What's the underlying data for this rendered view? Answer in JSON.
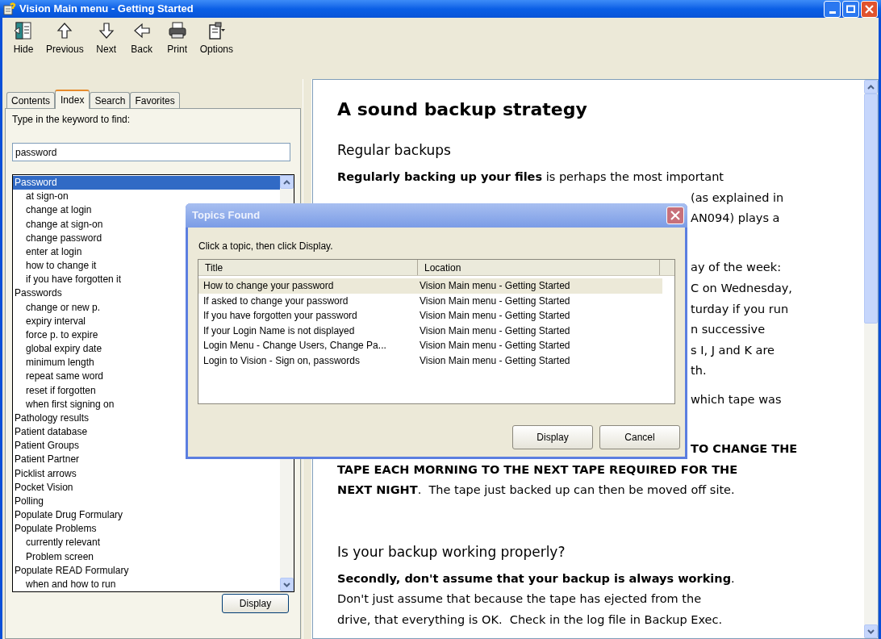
{
  "window": {
    "title": "Vision Main menu - Getting Started"
  },
  "toolbar": [
    {
      "kind": "hide",
      "label": "Hide"
    },
    {
      "kind": "up",
      "label": "Previous"
    },
    {
      "kind": "down",
      "label": "Next"
    },
    {
      "kind": "left",
      "label": "Back"
    },
    {
      "kind": "print",
      "label": "Print"
    },
    {
      "kind": "options",
      "label": "Options"
    }
  ],
  "navigation": {
    "tabs": [
      {
        "label": "Contents",
        "selected": false
      },
      {
        "label": "Index",
        "selected": true
      },
      {
        "label": "Search",
        "selected": false
      },
      {
        "label": "Favorites",
        "selected": false
      }
    ],
    "keyword_label": "Type in the keyword to find:",
    "keyword": "password",
    "index_items": [
      {
        "label": "Password",
        "selected": true,
        "children": [
          {
            "label": "at sign-on",
            "selected": false
          },
          {
            "label": "change at login",
            "selected": false
          },
          {
            "label": "change at sign-on",
            "selected": false
          },
          {
            "label": "change password",
            "selected": false
          },
          {
            "label": "enter at login",
            "selected": false
          },
          {
            "label": "how to change it",
            "selected": false
          },
          {
            "label": "if you have forgotten it",
            "selected": false
          }
        ]
      },
      {
        "label": "Passwords",
        "selected": false,
        "children": [
          {
            "label": "change or new p.",
            "selected": false
          },
          {
            "label": "expiry interval",
            "selected": false
          },
          {
            "label": "force p. to expire",
            "selected": false
          },
          {
            "label": "global expiry date",
            "selected": false
          },
          {
            "label": "minimum length",
            "selected": false
          },
          {
            "label": "repeat same word",
            "selected": false
          },
          {
            "label": "reset if forgotten",
            "selected": false
          },
          {
            "label": "when first signing on",
            "selected": false
          }
        ]
      },
      {
        "label": "Pathology results",
        "selected": false
      },
      {
        "label": "Patient database",
        "selected": false
      },
      {
        "label": "Patient Groups",
        "selected": false
      },
      {
        "label": "Patient Partner",
        "selected": false
      },
      {
        "label": "Picklist arrows",
        "selected": false
      },
      {
        "label": "Pocket Vision",
        "selected": false
      },
      {
        "label": "Polling",
        "selected": false
      },
      {
        "label": "Populate Drug Formulary",
        "selected": false
      },
      {
        "label": "Populate Problems",
        "selected": false,
        "children": [
          {
            "label": "currently relevant",
            "selected": false
          },
          {
            "label": "Problem screen",
            "selected": false
          }
        ]
      },
      {
        "label": "Populate READ Formulary",
        "selected": false,
        "children": [
          {
            "label": "when and how to run",
            "selected": false
          }
        ]
      }
    ],
    "display_button": "Display"
  },
  "article": {
    "title": "A sound backup strategy",
    "blocks": [
      {
        "kind": "heading",
        "text": "Regular backups"
      },
      {
        "kind": "line",
        "text": "**Regularly backing up your files** is perhaps the most important"
      },
      {
        "kind": "fragment",
        "text": "(as explained in"
      },
      {
        "kind": "fragment",
        "text": "AN094) plays a"
      },
      {
        "kind": "blank"
      },
      {
        "kind": "gap"
      },
      {
        "kind": "fragment",
        "text": "ay of the week:"
      },
      {
        "kind": "fragment",
        "text": "C on Wednesday,"
      },
      {
        "kind": "fragment",
        "text": "turday if you run"
      },
      {
        "kind": "fragment",
        "text": "n successive"
      },
      {
        "kind": "fragment",
        "text": "s I, J and K are"
      },
      {
        "kind": "fragment",
        "text": "th."
      },
      {
        "kind": "gap"
      },
      {
        "kind": "fragment",
        "text": "which tape was"
      },
      {
        "kind": "blank"
      },
      {
        "kind": "gap"
      },
      {
        "kind": "fragment",
        "text": "**TO CHANGE THE**"
      },
      {
        "kind": "line",
        "text": "**TAPE EACH MORNING TO THE NEXT TAPE REQUIRED FOR THE**"
      },
      {
        "kind": "line",
        "text": "**NEXT NIGHT**.  The tape just backed up can then be moved off site."
      },
      {
        "kind": "blank"
      },
      {
        "kind": "gap"
      },
      {
        "kind": "heading",
        "text": "Is your backup working properly?"
      },
      {
        "kind": "line",
        "text": "**Secondly, don't assume that your backup is always working**."
      },
      {
        "kind": "line",
        "text": "Don't just assume that because the tape has ejected from the"
      },
      {
        "kind": "line",
        "text": "drive, that everything is OK.  Check in the log file in Backup Exec."
      }
    ]
  },
  "dialog": {
    "title": "Topics Found",
    "instruction": "Click a topic, then click Display.",
    "columns": [
      "Title",
      "Location"
    ],
    "rows": [
      {
        "title": "How to change your password",
        "location": "Vision Main menu - Getting Started",
        "selected": true
      },
      {
        "title": "If asked to change your password",
        "location": "Vision Main menu - Getting Started",
        "selected": false
      },
      {
        "title": "If you have forgotten your password",
        "location": "Vision Main menu - Getting Started",
        "selected": false
      },
      {
        "title": "If your Login Name is not displayed",
        "location": "Vision Main menu - Getting Started",
        "selected": false
      },
      {
        "title": "Login Menu - Change Users, Change Pa...",
        "location": "Vision Main menu - Getting Started",
        "selected": false
      },
      {
        "title": "Login to Vision - Sign on, passwords",
        "location": "Vision Main menu - Getting Started",
        "selected": false
      }
    ],
    "buttons": [
      "Display",
      "Cancel"
    ]
  }
}
